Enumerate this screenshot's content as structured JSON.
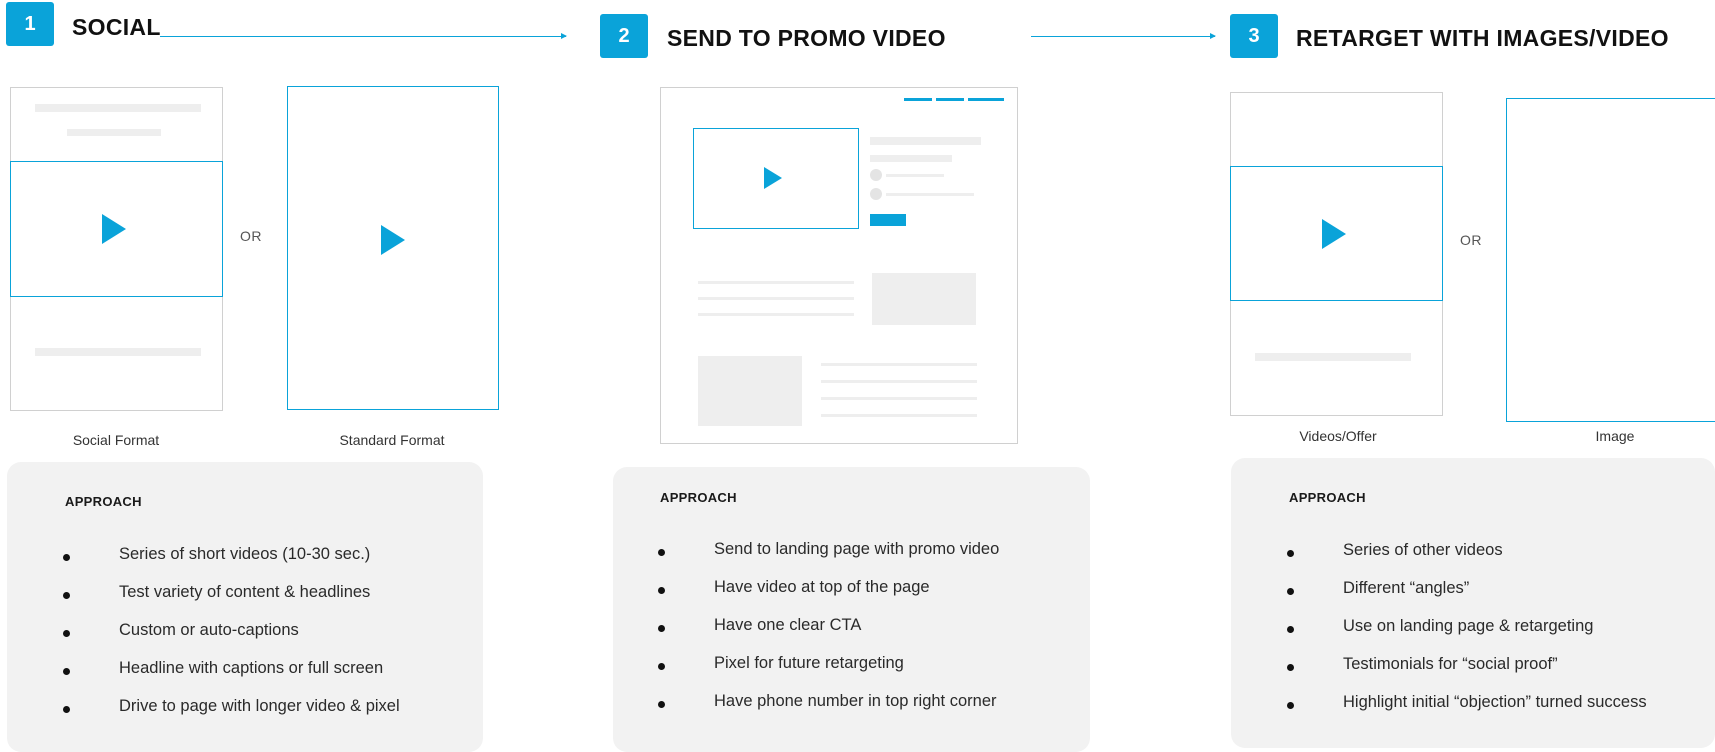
{
  "colors": {
    "accent": "#0aa3d9",
    "panel_bg": "#f2f2f2",
    "placeholder": "#eeeeee"
  },
  "steps": [
    {
      "number": "1",
      "title": "SOCIAL",
      "option_separator": "OR",
      "captions": [
        "Social Format",
        "Standard Format"
      ],
      "approach": {
        "heading": "APPROACH",
        "items": [
          "Series of short videos (10-30 sec.)",
          "Test variety of content & headlines",
          "Custom or auto-captions",
          "Headline with captions or full screen",
          "Drive to page with longer video & pixel"
        ]
      }
    },
    {
      "number": "2",
      "title": "SEND TO PROMO VIDEO",
      "approach": {
        "heading": "APPROACH",
        "items": [
          "Send to landing page with promo video",
          "Have video at top of the page",
          "Have one clear CTA",
          "Pixel for future retargeting",
          "Have phone number in top right corner"
        ]
      }
    },
    {
      "number": "3",
      "title": "RETARGET WITH IMAGES/VIDEO",
      "option_separator": "OR",
      "captions": [
        "Videos/Offer",
        "Image"
      ],
      "approach": {
        "heading": "APPROACH",
        "items": [
          "Series of other videos",
          "Different “angles”",
          "Use on landing page & retargeting",
          "Testimonials for “social proof”",
          "Highlight initial “objection” turned success"
        ]
      }
    }
  ]
}
